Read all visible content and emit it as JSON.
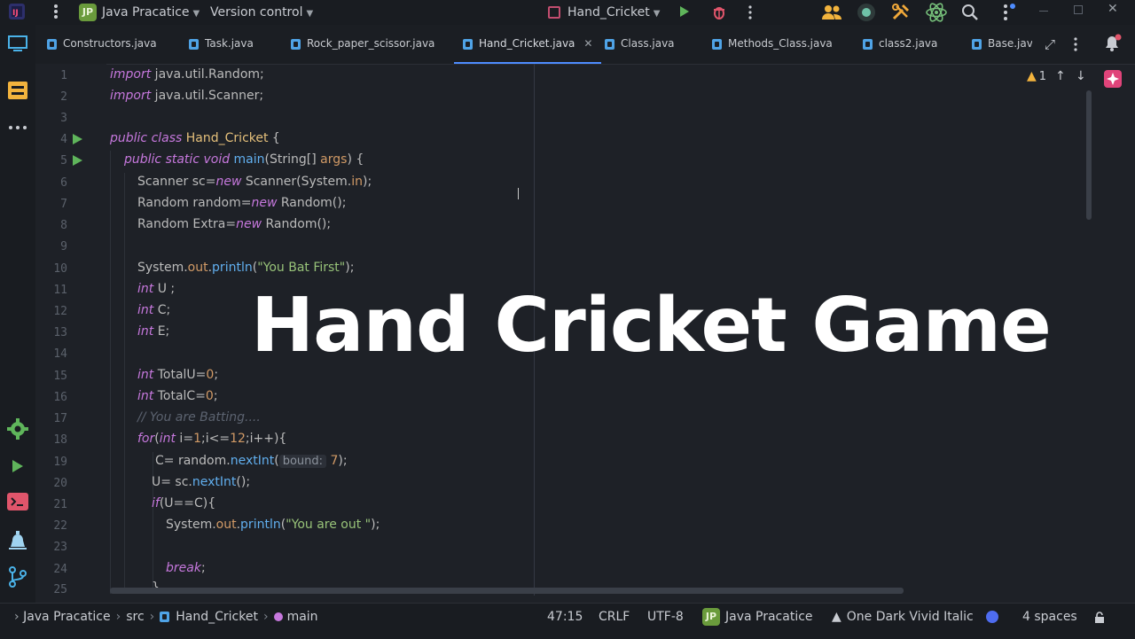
{
  "title_bar": {
    "project_badge": "JP",
    "project_name": "Java Pracatice",
    "version_control": "Version control",
    "run_config": "Hand_Cricket"
  },
  "tabs": [
    {
      "label": "Constructors.java",
      "active": false
    },
    {
      "label": "Task.java",
      "active": false
    },
    {
      "label": "Rock_paper_scissor.java",
      "active": false
    },
    {
      "label": "Hand_Cricket.java",
      "active": true
    },
    {
      "label": "Class.java",
      "active": false
    },
    {
      "label": "Methods_Class.java",
      "active": false
    },
    {
      "label": "class2.java",
      "active": false
    },
    {
      "label": "Base.java",
      "active": false
    }
  ],
  "inspections": {
    "warnings": "1"
  },
  "editor": {
    "line_numbers": [
      "1",
      "2",
      "3",
      "4",
      "5",
      "6",
      "7",
      "8",
      "9",
      "10",
      "11",
      "12",
      "13",
      "14",
      "15",
      "16",
      "17",
      "18",
      "19",
      "20",
      "21",
      "22",
      "23",
      "24",
      "25"
    ],
    "lines": {
      "l1_kw": "import",
      "l1_rest": " java.util.Random;",
      "l2_kw": "import",
      "l2_rest": " java.util.Scanner;",
      "l4_kw": "public class",
      "l4_name": " Hand_Cricket",
      "l4_rest": " {",
      "l5_kw": "public static void",
      "l5_fn": " main",
      "l5_a": "(String[] ",
      "l5_arg": "args",
      "l5_b": ") {",
      "l6_a": "Scanner sc=",
      "l6_kw": "new",
      "l6_b": " Scanner(System.",
      "l6_field": "in",
      "l6_c": ");",
      "l7_a": "Random random=",
      "l7_kw": "new",
      "l7_b": " Random();",
      "l8_a": "Random Extra=",
      "l8_kw": "new",
      "l8_b": " Random();",
      "l10_a": "System.",
      "l10_field": "out",
      "l10_dot": ".",
      "l10_fn": "println",
      "l10_b": "(",
      "l10_str": "\"You Bat First\"",
      "l10_c": ");",
      "l11_kw": "int",
      "l11_rest": " U ;",
      "l12_kw": "int",
      "l12_rest": " C;",
      "l13_kw": "int",
      "l13_rest": " E;",
      "l15_kw": "int",
      "l15_a": " TotalU=",
      "l15_num": "0",
      "l15_b": ";",
      "l16_kw": "int",
      "l16_a": " TotalC=",
      "l16_num": "0",
      "l16_b": ";",
      "l17_cmt": "// You are Batting....",
      "l18_kw": "for",
      "l18_a": "(",
      "l18_kw2": "int",
      "l18_b": " i=",
      "l18_n1": "1",
      "l18_c": ";i<=",
      "l18_n2": "12",
      "l18_d": ";i++){",
      "l19_a": "C= random.",
      "l19_fn": "nextInt",
      "l19_b": "(",
      "l19_hint": "bound:",
      "l19_num": " 7",
      "l19_c": ");",
      "l20_a": "U= sc.",
      "l20_fn": "nextInt",
      "l20_b": "();",
      "l21_kw": "if",
      "l21_rest": "(U==C){",
      "l22_a": "System.",
      "l22_field": "out",
      "l22_dot": ".",
      "l22_fn": "println",
      "l22_b": "(",
      "l22_str": "\"You are out \"",
      "l22_c": ");",
      "l24_kw": "break",
      "l24_rest": ";",
      "l25": "}"
    }
  },
  "overlay": {
    "title": "Hand Cricket Game"
  },
  "status_bar": {
    "crumb_project": "Java Pracatice",
    "crumb_src": "src",
    "crumb_class": "Hand_Cricket",
    "crumb_method": "main",
    "position": "47:15",
    "line_separator": "CRLF",
    "encoding": "UTF-8",
    "project_badge": "JP",
    "project_name": "Java Pracatice",
    "theme": "One Dark Vivid Italic",
    "indent": "4 spaces"
  },
  "colors": {
    "accent": "#4e8cff",
    "run": "#5fb55b",
    "keyword": "#c678dd",
    "string": "#98c379",
    "function": "#61afef",
    "type": "#e5c07b",
    "number": "#d19a66"
  },
  "icons": [
    "project-icon",
    "hamburger-menu-icon",
    "run-icon",
    "debug-icon",
    "more-icon",
    "users-icon",
    "record-icon",
    "tools-icon",
    "atom-icon",
    "search-icon",
    "settings-icon",
    "minimize-icon",
    "maximize-icon",
    "close-icon",
    "folder-icon",
    "structure-icon",
    "notifications-icon",
    "ai-assistant-icon",
    "gear-icon",
    "play-icon",
    "terminal-icon",
    "problems-icon",
    "git-icon",
    "warning-icon",
    "arrow-up-icon",
    "arrow-down-icon",
    "expand-icon",
    "lock-icon"
  ]
}
